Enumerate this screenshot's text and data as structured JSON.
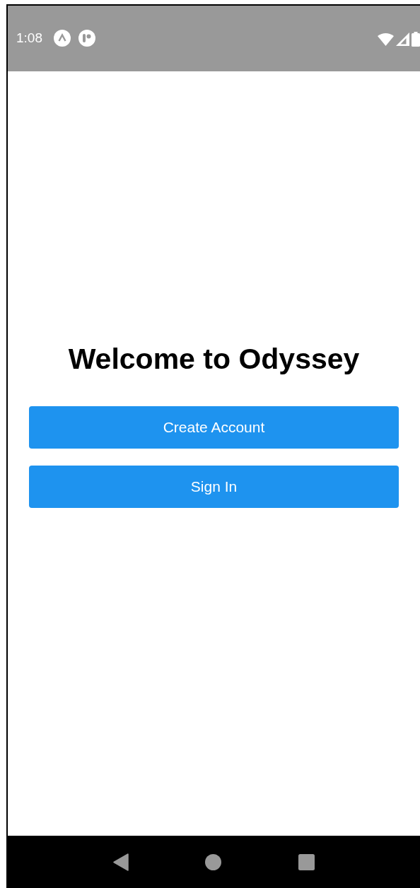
{
  "status_bar": {
    "time": "1:08"
  },
  "title": "Welcome to Odyssey",
  "buttons": [
    "Create Account",
    "Sign In"
  ]
}
